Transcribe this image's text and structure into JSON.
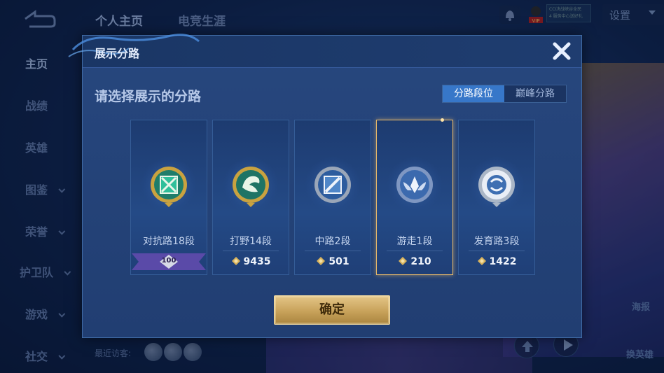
{
  "top_bar": {
    "tabs": [
      "个人主页",
      "电竞生涯"
    ],
    "settings_label": "设置",
    "promo_text": [
      "CCI决战峡谷全民",
      "4 服务中心送好礼"
    ]
  },
  "sidebar": {
    "items": [
      {
        "label": "主页",
        "has_chevron": false
      },
      {
        "label": "战绩",
        "has_chevron": false
      },
      {
        "label": "英雄",
        "has_chevron": false
      },
      {
        "label": "图鉴",
        "has_chevron": true
      },
      {
        "label": "荣誉",
        "has_chevron": true
      },
      {
        "label": "护卫队",
        "has_chevron": true
      },
      {
        "label": "游戏",
        "has_chevron": true
      },
      {
        "label": "社交",
        "has_chevron": true
      }
    ]
  },
  "footer": {
    "recent_visitors_label": "最近访客:"
  },
  "right_side": {
    "labels": [
      "海报",
      "换英雄"
    ]
  },
  "dialog": {
    "title": "展示分路",
    "prompt": "请选择展示的分路",
    "segments": [
      {
        "label": "分路段位",
        "active": true
      },
      {
        "label": "巅峰分路",
        "active": false
      }
    ],
    "cards": [
      {
        "label": "对抗路18段",
        "score": "100",
        "score_type": "ribbon",
        "icon": "clash-lane-badge-icon",
        "selected": false
      },
      {
        "label": "打野14段",
        "score": "9435",
        "score_type": "gem",
        "icon": "jungle-dragon-badge-icon",
        "selected": false
      },
      {
        "label": "中路2段",
        "score": "501",
        "score_type": "gem",
        "icon": "mid-lane-badge-icon",
        "selected": false
      },
      {
        "label": "游走1段",
        "score": "210",
        "score_type": "gem",
        "icon": "roam-wings-badge-icon",
        "selected": true
      },
      {
        "label": "发育路3段",
        "score": "1422",
        "score_type": "gem",
        "icon": "farm-lane-badge-icon",
        "selected": false
      }
    ],
    "confirm_label": "确定"
  },
  "colors": {
    "accent_blue": "#3777c9",
    "confirm_gold": "#c8a25a",
    "selected_border": "#e8b96a"
  }
}
